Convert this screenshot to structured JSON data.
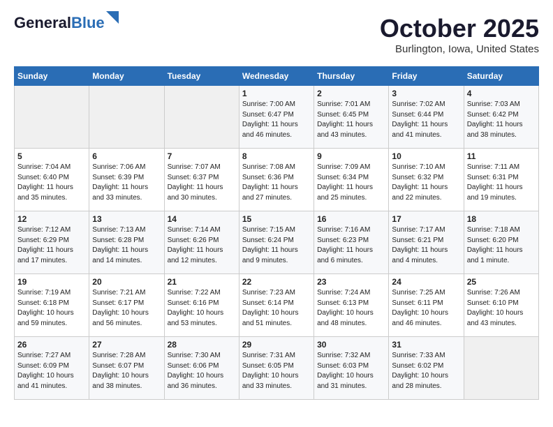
{
  "header": {
    "logo_general": "General",
    "logo_blue": "Blue",
    "month_title": "October 2025",
    "location": "Burlington, Iowa, United States"
  },
  "weekdays": [
    "Sunday",
    "Monday",
    "Tuesday",
    "Wednesday",
    "Thursday",
    "Friday",
    "Saturday"
  ],
  "weeks": [
    [
      {
        "day": "",
        "info": ""
      },
      {
        "day": "",
        "info": ""
      },
      {
        "day": "",
        "info": ""
      },
      {
        "day": "1",
        "info": "Sunrise: 7:00 AM\nSunset: 6:47 PM\nDaylight: 11 hours\nand 46 minutes."
      },
      {
        "day": "2",
        "info": "Sunrise: 7:01 AM\nSunset: 6:45 PM\nDaylight: 11 hours\nand 43 minutes."
      },
      {
        "day": "3",
        "info": "Sunrise: 7:02 AM\nSunset: 6:44 PM\nDaylight: 11 hours\nand 41 minutes."
      },
      {
        "day": "4",
        "info": "Sunrise: 7:03 AM\nSunset: 6:42 PM\nDaylight: 11 hours\nand 38 minutes."
      }
    ],
    [
      {
        "day": "5",
        "info": "Sunrise: 7:04 AM\nSunset: 6:40 PM\nDaylight: 11 hours\nand 35 minutes."
      },
      {
        "day": "6",
        "info": "Sunrise: 7:06 AM\nSunset: 6:39 PM\nDaylight: 11 hours\nand 33 minutes."
      },
      {
        "day": "7",
        "info": "Sunrise: 7:07 AM\nSunset: 6:37 PM\nDaylight: 11 hours\nand 30 minutes."
      },
      {
        "day": "8",
        "info": "Sunrise: 7:08 AM\nSunset: 6:36 PM\nDaylight: 11 hours\nand 27 minutes."
      },
      {
        "day": "9",
        "info": "Sunrise: 7:09 AM\nSunset: 6:34 PM\nDaylight: 11 hours\nand 25 minutes."
      },
      {
        "day": "10",
        "info": "Sunrise: 7:10 AM\nSunset: 6:32 PM\nDaylight: 11 hours\nand 22 minutes."
      },
      {
        "day": "11",
        "info": "Sunrise: 7:11 AM\nSunset: 6:31 PM\nDaylight: 11 hours\nand 19 minutes."
      }
    ],
    [
      {
        "day": "12",
        "info": "Sunrise: 7:12 AM\nSunset: 6:29 PM\nDaylight: 11 hours\nand 17 minutes."
      },
      {
        "day": "13",
        "info": "Sunrise: 7:13 AM\nSunset: 6:28 PM\nDaylight: 11 hours\nand 14 minutes."
      },
      {
        "day": "14",
        "info": "Sunrise: 7:14 AM\nSunset: 6:26 PM\nDaylight: 11 hours\nand 12 minutes."
      },
      {
        "day": "15",
        "info": "Sunrise: 7:15 AM\nSunset: 6:24 PM\nDaylight: 11 hours\nand 9 minutes."
      },
      {
        "day": "16",
        "info": "Sunrise: 7:16 AM\nSunset: 6:23 PM\nDaylight: 11 hours\nand 6 minutes."
      },
      {
        "day": "17",
        "info": "Sunrise: 7:17 AM\nSunset: 6:21 PM\nDaylight: 11 hours\nand 4 minutes."
      },
      {
        "day": "18",
        "info": "Sunrise: 7:18 AM\nSunset: 6:20 PM\nDaylight: 11 hours\nand 1 minute."
      }
    ],
    [
      {
        "day": "19",
        "info": "Sunrise: 7:19 AM\nSunset: 6:18 PM\nDaylight: 10 hours\nand 59 minutes."
      },
      {
        "day": "20",
        "info": "Sunrise: 7:21 AM\nSunset: 6:17 PM\nDaylight: 10 hours\nand 56 minutes."
      },
      {
        "day": "21",
        "info": "Sunrise: 7:22 AM\nSunset: 6:16 PM\nDaylight: 10 hours\nand 53 minutes."
      },
      {
        "day": "22",
        "info": "Sunrise: 7:23 AM\nSunset: 6:14 PM\nDaylight: 10 hours\nand 51 minutes."
      },
      {
        "day": "23",
        "info": "Sunrise: 7:24 AM\nSunset: 6:13 PM\nDaylight: 10 hours\nand 48 minutes."
      },
      {
        "day": "24",
        "info": "Sunrise: 7:25 AM\nSunset: 6:11 PM\nDaylight: 10 hours\nand 46 minutes."
      },
      {
        "day": "25",
        "info": "Sunrise: 7:26 AM\nSunset: 6:10 PM\nDaylight: 10 hours\nand 43 minutes."
      }
    ],
    [
      {
        "day": "26",
        "info": "Sunrise: 7:27 AM\nSunset: 6:09 PM\nDaylight: 10 hours\nand 41 minutes."
      },
      {
        "day": "27",
        "info": "Sunrise: 7:28 AM\nSunset: 6:07 PM\nDaylight: 10 hours\nand 38 minutes."
      },
      {
        "day": "28",
        "info": "Sunrise: 7:30 AM\nSunset: 6:06 PM\nDaylight: 10 hours\nand 36 minutes."
      },
      {
        "day": "29",
        "info": "Sunrise: 7:31 AM\nSunset: 6:05 PM\nDaylight: 10 hours\nand 33 minutes."
      },
      {
        "day": "30",
        "info": "Sunrise: 7:32 AM\nSunset: 6:03 PM\nDaylight: 10 hours\nand 31 minutes."
      },
      {
        "day": "31",
        "info": "Sunrise: 7:33 AM\nSunset: 6:02 PM\nDaylight: 10 hours\nand 28 minutes."
      },
      {
        "day": "",
        "info": ""
      }
    ]
  ]
}
